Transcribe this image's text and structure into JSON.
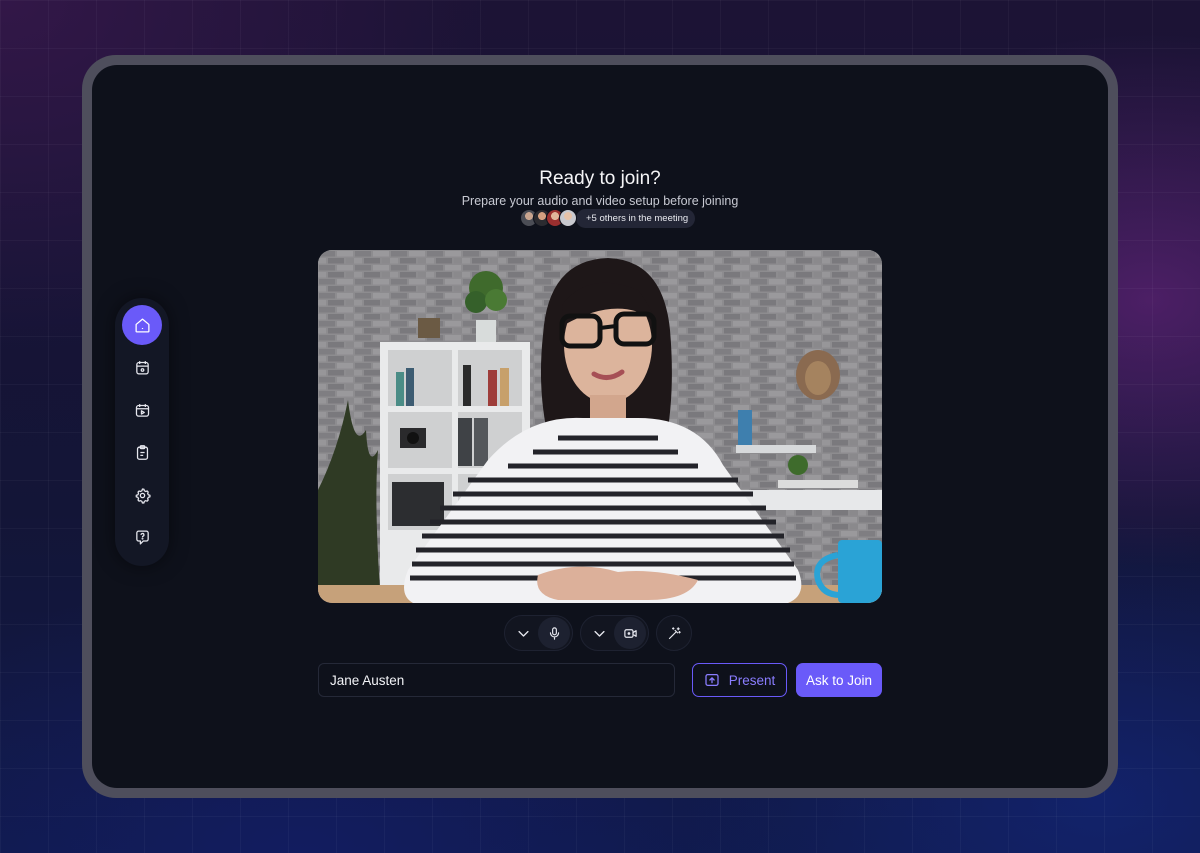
{
  "header": {
    "title": "Ready to join?",
    "subtitle": "Prepare your audio and video setup before joining"
  },
  "participants": {
    "others_label": "+5 others in the meeting",
    "avatar_count": 4
  },
  "sidebar": {
    "items": [
      {
        "name": "home",
        "icon": "home-icon",
        "active": true
      },
      {
        "name": "calendar",
        "icon": "calendar-icon",
        "active": false
      },
      {
        "name": "recordings",
        "icon": "video-calendar-icon",
        "active": false
      },
      {
        "name": "notes",
        "icon": "clipboard-icon",
        "active": false
      },
      {
        "name": "settings",
        "icon": "gear-icon",
        "active": false
      },
      {
        "name": "help",
        "icon": "help-chat-icon",
        "active": false
      }
    ]
  },
  "controls": {
    "audio": {
      "icon": "microphone-icon",
      "dropdown_icon": "chevron-down-icon"
    },
    "video": {
      "icon": "camera-icon",
      "dropdown_icon": "chevron-down-icon"
    },
    "effects": {
      "icon": "magic-wand-icon"
    }
  },
  "name_field": {
    "value": "Jane Austen"
  },
  "actions": {
    "present_label": "Present",
    "join_label": "Ask to Join"
  },
  "colors": {
    "accent": "#6a5af9",
    "screen_bg": "#0e111b",
    "frame": "#4e4e5c"
  }
}
